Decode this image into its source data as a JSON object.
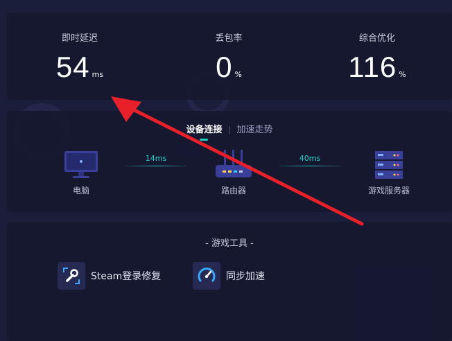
{
  "stats": [
    {
      "label": "即时延迟",
      "value": "54",
      "unit": "ms"
    },
    {
      "label": "丢包率",
      "value": "0",
      "unit": "%"
    },
    {
      "label": "综合优化",
      "value": "116",
      "unit": "%"
    }
  ],
  "connection": {
    "tabs": [
      {
        "label": "设备连接",
        "active": true
      },
      {
        "label": "加速走势",
        "active": false
      }
    ],
    "devices": [
      {
        "label": "电脑",
        "icon": "computer-icon"
      },
      {
        "label": "路由器",
        "icon": "router-icon"
      },
      {
        "label": "游戏服务器",
        "icon": "game-server-icon"
      }
    ],
    "links": [
      {
        "latency": "14ms"
      },
      {
        "latency": "40ms"
      }
    ]
  },
  "tools": {
    "title": "- 游戏工具 -",
    "items": [
      {
        "label": "Steam登录修复",
        "icon": "wrench-icon"
      },
      {
        "label": "同步加速",
        "icon": "speedometer-icon"
      }
    ]
  },
  "colors": {
    "background": "#1b1e3a",
    "card": "#161830",
    "accent": "#28d3c4",
    "annotation_arrow": "#e8202a"
  }
}
